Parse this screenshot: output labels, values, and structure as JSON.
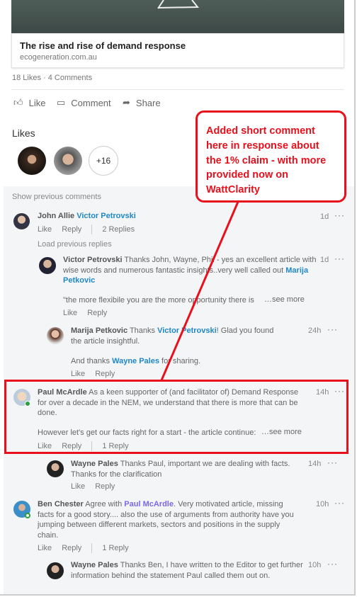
{
  "article": {
    "title": "The rise and rise of demand response",
    "url": "ecogeneration.com.au"
  },
  "stats": "18 Likes · 4 Comments",
  "actions": {
    "like": "Like",
    "comment": "Comment",
    "share": "Share"
  },
  "likes": {
    "heading": "Likes",
    "more": "+16"
  },
  "show_previous": "Show previous comments",
  "load_previous": "Load previous replies",
  "labels": {
    "like": "Like",
    "reply": "Reply",
    "see_more": "…see more"
  },
  "comments": [
    {
      "author": "John Allie",
      "mention": "Victor Petrovski",
      "time": "1d",
      "replies": "2 Replies"
    },
    {
      "author": "Victor Petrovski",
      "text": "Thanks John, Wayne, Phil - yes an excellent article with wise words and numerous fantastic insights..very well called out",
      "mention": "Marija Petkovic",
      "text2": "\"the more flexibile you are the more opportunity there is",
      "time": "1d"
    },
    {
      "author": "Marija Petkovic",
      "pre": "Thanks",
      "mention": "Victor Petrovski",
      "text": "! Glad you found the article insightful.",
      "pre2": "And thanks",
      "mention2": "Wayne Pales",
      "text2": "for sharing.",
      "time": "24h"
    },
    {
      "author": "Paul McArdle",
      "text": "As a keen supporter of (and facilitator of) Demand Response for over a decade in the NEM, we understand that there is more that can be done.",
      "text2": "However let's get our facts right for a start - the article continue:",
      "time": "14h",
      "replies": "1 Reply"
    },
    {
      "author": "Wayne Pales",
      "text": "Thanks Paul, important we are dealing with facts. Thanks for the clarification",
      "time": "14h"
    },
    {
      "author": "Ben Chester",
      "pre": "Agree with",
      "mention": "Paul McArdle",
      "text": ". Very motivated article, missing facts for a good story.... also the use of arguments from authority have you jumping between different markets, sectors and positions in the supply chain.",
      "time": "10h",
      "replies": "1 Reply"
    },
    {
      "author": "Wayne Pales",
      "text": "Thanks Ben, I have written to the Editor to get further information behind the statement Paul called them out on.",
      "time": "10h"
    }
  ],
  "annotation": "Added short comment here in response about the 1% claim - with more provided now on WattClarity",
  "colors": {
    "annotation": "#e8101c",
    "link": "#1f88c8",
    "background": "#f3f5f7"
  }
}
